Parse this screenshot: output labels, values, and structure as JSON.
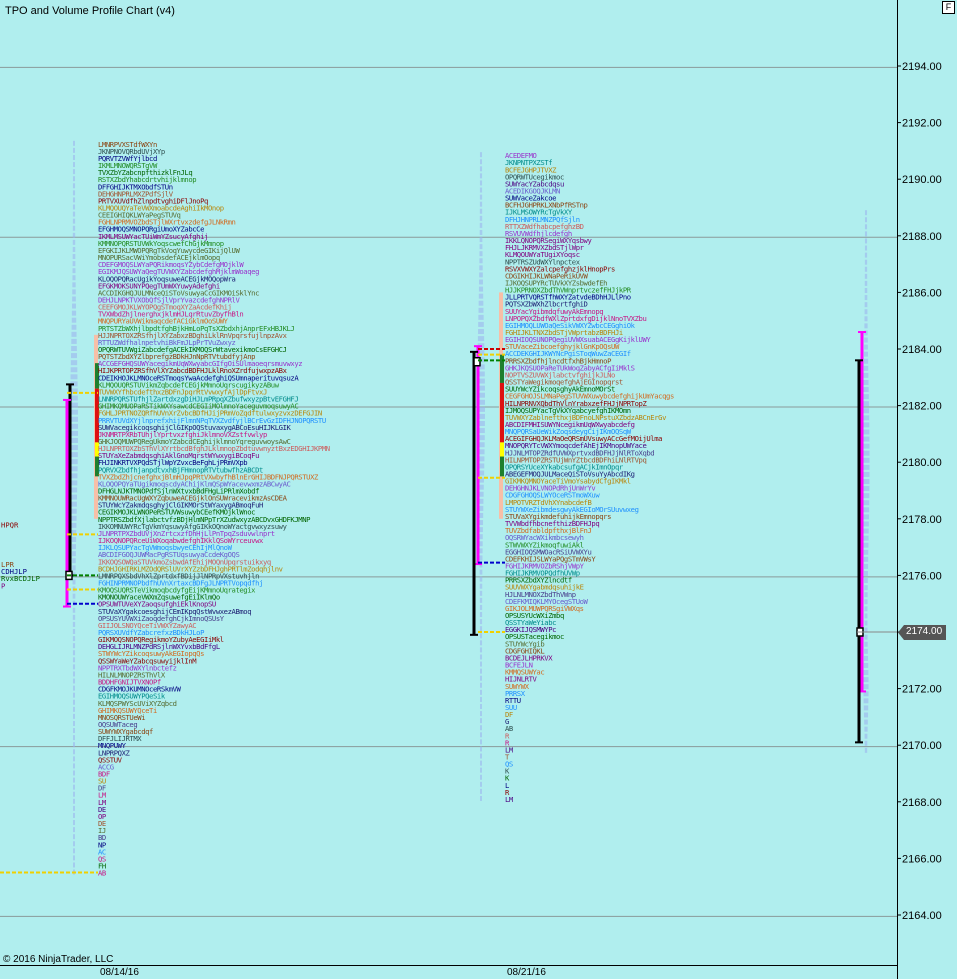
{
  "header": {
    "title": "TPO and Volume Profile Chart (v4)",
    "f_button": "F"
  },
  "footer": {
    "copyright": "© 2016 NinjaTrader, LLC",
    "dates": [
      "08/14/16",
      "08/21/16"
    ]
  },
  "last_price": "2174.00",
  "colors": {
    "background": "#b0eeee",
    "value_area": "#f7bfa7",
    "poc_green": "#1e7f2e",
    "ib_red": "#dd1111",
    "ib_yellow": "#ffff00",
    "range_magenta": "#ff00ff",
    "range_black": "#000000",
    "volume_blue": "#9ab0ee",
    "poc_line_yellow": "#f0d000",
    "poc_line_blue": "#0000cc",
    "poc_line_green": "#008000",
    "poc_line_red": "#cc0000",
    "price_tag": "#555555"
  },
  "chart_data": {
    "type": "tpo_market_profile",
    "y_axis": {
      "ticks": [
        "2194.00",
        "2192.00",
        "2190.00",
        "2188.00",
        "2186.00",
        "2184.00",
        "2182.00",
        "2180.00",
        "2178.00",
        "2176.00",
        "2174.00",
        "2172.00",
        "2170.00",
        "2168.00",
        "2166.00",
        "2164.00"
      ],
      "range": [
        2162.5,
        2195.5
      ],
      "gridlines_at": [
        2193.95,
        2187.95,
        2181.95,
        2175.95,
        2169.95,
        2163.95
      ]
    },
    "sessions": [
      {
        "date": "08/14/16",
        "high": 2191.25,
        "low": 2165.5,
        "value_area": [
          2178.0,
          2184.5
        ],
        "range_lines": [
          {
            "color": "black",
            "from": 2176.0,
            "to": 2182.75
          },
          {
            "color": "magenta",
            "from": 2174.9,
            "to": 2182.2
          }
        ],
        "ib_bars": [
          {
            "color": "green",
            "from": 2182.6,
            "to": 2183.5
          },
          {
            "color": "red",
            "from": 2180.7,
            "to": 2182.6
          },
          {
            "color": "yellow",
            "from": 2180.2,
            "to": 2180.7
          },
          {
            "color": "green",
            "from": 2179.5,
            "to": 2180.2
          }
        ],
        "ref_lines": [
          {
            "color": "yellow",
            "price": 2182.45,
            "from": "profile",
            "to": "range"
          },
          {
            "color": "yellow",
            "price": 2177.45,
            "from": "profile",
            "to": "range"
          },
          {
            "color": "green",
            "price": 2176.0,
            "from": "profile",
            "to": "range"
          },
          {
            "color": "yellow",
            "price": 2175.5,
            "from": "profile",
            "to": "range"
          },
          {
            "color": "blue",
            "price": 2175.0,
            "from": "profile",
            "to": "range"
          },
          {
            "color": "yellow",
            "price": 2165.5,
            "from": "left",
            "to": "profile"
          }
        ]
      },
      {
        "date": "08/21/16",
        "high": 2190.85,
        "low": 2168.1,
        "value_area": [
          2178.0,
          2186.0
        ],
        "range_lines": [
          {
            "color": "magenta",
            "from": 2176.4,
            "to": 2184.1
          },
          {
            "color": "black",
            "from": 2173.9,
            "to": 2183.9
          }
        ],
        "ib_bars": [
          {
            "color": "green",
            "from": 2182.8,
            "to": 2183.8
          },
          {
            "color": "red",
            "from": 2180.7,
            "to": 2182.8
          },
          {
            "color": "yellow",
            "from": 2180.2,
            "to": 2180.7
          },
          {
            "color": "green",
            "from": 2179.5,
            "to": 2180.2
          }
        ],
        "ref_lines": [
          {
            "color": "red",
            "price": 2184.0,
            "from": "range",
            "to": "profile"
          },
          {
            "color": "yellow",
            "price": 2183.8,
            "from": "range",
            "to": "profile"
          },
          {
            "color": "green",
            "price": 2183.6,
            "from": "range",
            "to": "profile"
          },
          {
            "color": "yellow",
            "price": 2179.45,
            "from": "range",
            "to": "profile"
          },
          {
            "color": "blue",
            "price": 2176.45,
            "from": "range",
            "to": "profile"
          },
          {
            "color": "yellow",
            "price": 2174.0,
            "from": "range",
            "to": "profile"
          }
        ]
      },
      {
        "date": "",
        "current_session": true,
        "range_lines": [
          {
            "color": "magenta",
            "from": 2171.9,
            "to": 2184.6
          },
          {
            "color": "black",
            "from": 2170.1,
            "to": 2183.6
          }
        ]
      }
    ]
  }
}
